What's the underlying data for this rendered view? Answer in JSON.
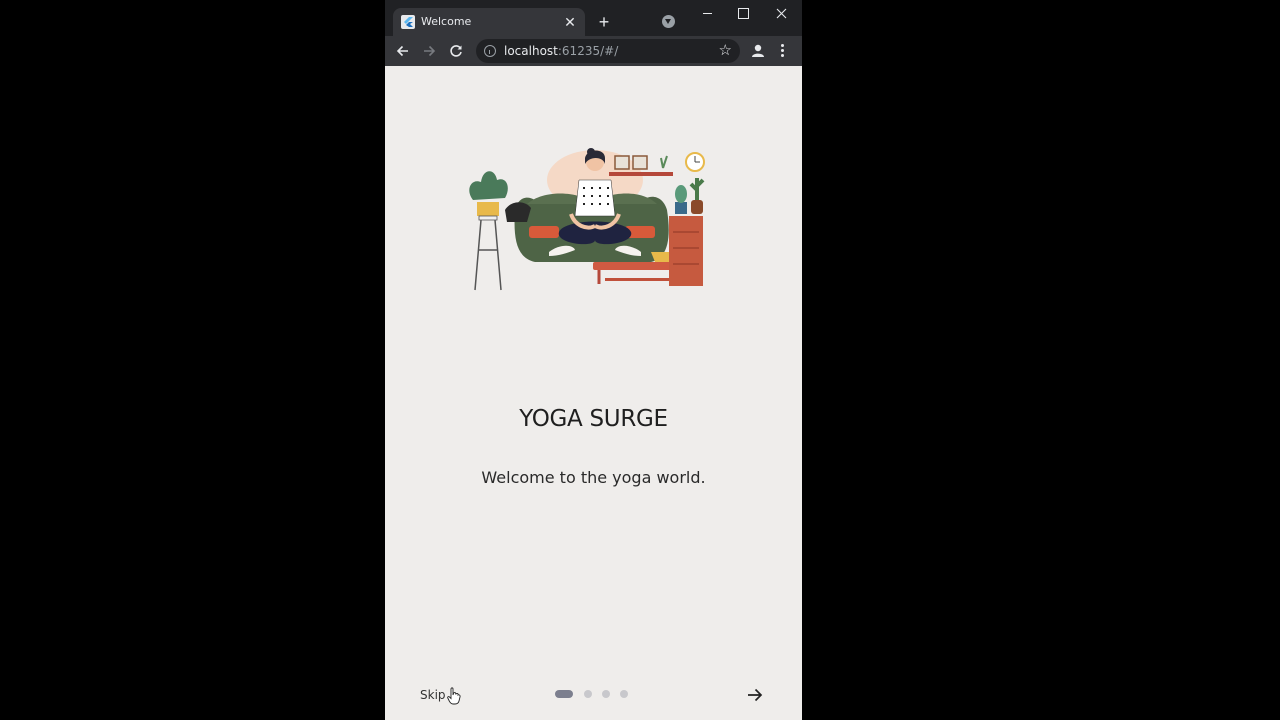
{
  "browser": {
    "tab_title": "Welcome",
    "url_host": "localhost",
    "url_rest": ":61235/#/"
  },
  "page": {
    "title": "YOGA SURGE",
    "subtitle": "Welcome to the yoga world.",
    "skip_label": "Skip",
    "pages_total": 4,
    "current_page": 1
  },
  "icons": {
    "back": "arrow-left-icon",
    "forward": "arrow-right-icon",
    "reload": "reload-icon",
    "next": "arrow-right-icon"
  },
  "colors": {
    "background": "#efedeb",
    "active_dot": "#7c7f8e",
    "inactive_dot": "#c8c8cc"
  }
}
